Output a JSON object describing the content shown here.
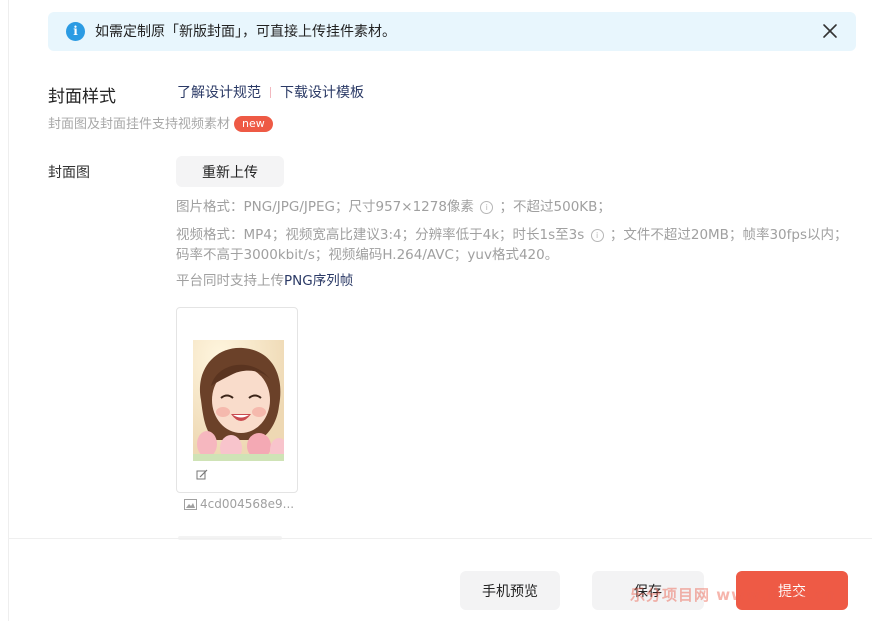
{
  "notice": {
    "text": "如需定制原「新版封面」，可直接上传挂件素材。",
    "icon": "info-icon",
    "close_icon": "close-icon"
  },
  "cover_style": {
    "title": "封面样式",
    "link_guide": "了解设计规范",
    "link_template": "下载设计模板",
    "subtitle": "封面图及封面挂件支持视频素材",
    "badge": "new"
  },
  "cover_image": {
    "label": "封面图",
    "reupload_label": "重新上传",
    "spec_image_a": "图片格式：PNG/JPG/JPEG；尺寸957×1278像素",
    "spec_image_b": "；不超过500KB；",
    "spec_video_a": "视频格式：MP4；视频宽高比建议3:4；分辨率低于4k；时长1s至3s",
    "spec_video_b": "；文件不超过20MB；帧率30fps以内；码率不高于3000kbit/s；视频编码H.264/AVC；yuv格式420。",
    "spec_png_prefix": "平台同时支持上传",
    "spec_png_link": "PNG序列帧",
    "info_glyph": "i",
    "file_name": "4cd004568e9..."
  },
  "footer": {
    "preview_label": "手机预览",
    "save_label": "保存",
    "submit_label": "提交"
  },
  "watermark": "乐分项目网 www.lfxm.cn",
  "colors": {
    "accent": "#ee5a45",
    "notice_bg": "#e8f6fd",
    "info_blue": "#2b9be3",
    "link": "#2b3a66"
  }
}
